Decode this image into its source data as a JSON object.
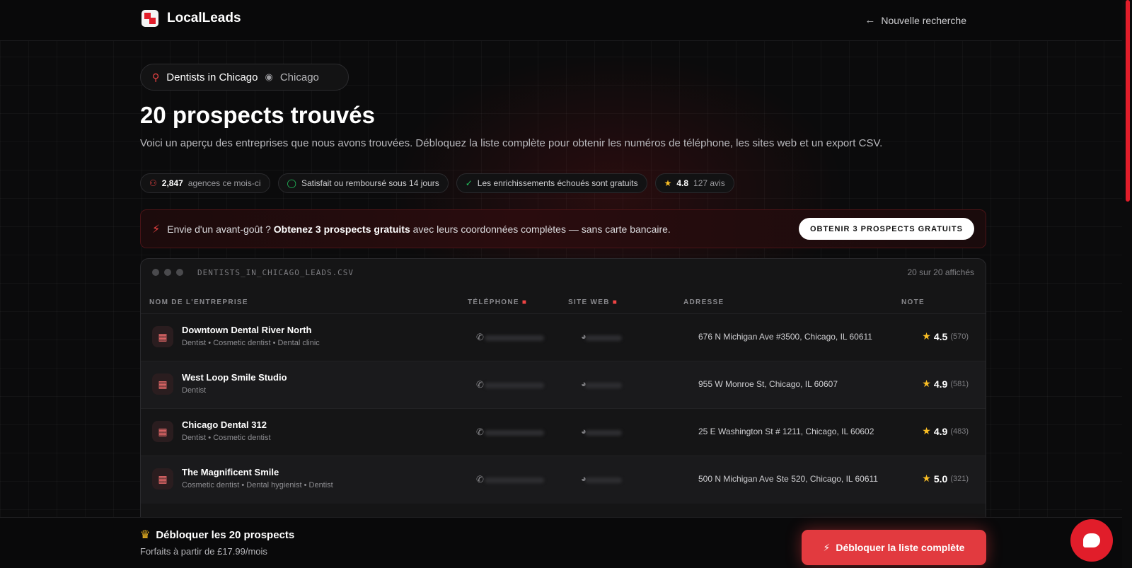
{
  "header": {
    "brand": "LocalLeads",
    "new_search": "Nouvelle recherche"
  },
  "search": {
    "query": "Dentists in Chicago",
    "location": "Chicago"
  },
  "main": {
    "title": "20 prospects trouvés",
    "intro": "Voici un aperçu des entreprises que nous avons trouvées. Débloquez la liste complète pour obtenir les numéros de téléphone, les sites web et un export CSV."
  },
  "badges": {
    "agencies_count": "2,847",
    "agencies_label": "agences ce mois-ci",
    "refund": "Satisfait ou remboursé sous 14 jours",
    "enrich": "Les enrichissements échoués sont gratuits",
    "rating": "4.8",
    "reviews": "127 avis"
  },
  "promo": {
    "lead": "Envie d'un avant-goût ?",
    "bold": "Obtenez 3 prospects gratuits",
    "rest": "avec leurs coordonnées complètes — sans carte bancaire.",
    "button": "OBTENIR 3 PROSPECTS GRATUITS"
  },
  "table": {
    "filename": "DENTISTS_IN_CHICAGO_LEADS.CSV",
    "shown": "20 sur 20 affichés",
    "headers": {
      "name": "NOM DE L'ENTREPRISE",
      "phone": "TÉLÉPHONE",
      "website": "SITE WEB",
      "address": "ADRESSE",
      "rating": "NOTE"
    },
    "rows": [
      {
        "name": "Downtown Dental River North",
        "categories": "Dentist • Cosmetic dentist • Dental clinic",
        "address": "676 N Michigan Ave #3500, Chicago, IL 60611",
        "rating": "4.5",
        "reviews": "(570)"
      },
      {
        "name": "West Loop Smile Studio",
        "categories": "Dentist",
        "address": "955 W Monroe St, Chicago, IL 60607",
        "rating": "4.9",
        "reviews": "(581)"
      },
      {
        "name": "Chicago Dental 312",
        "categories": "Dentist • Cosmetic dentist",
        "address": "25 E Washington St # 1211, Chicago, IL 60602",
        "rating": "4.9",
        "reviews": "(483)"
      },
      {
        "name": "The Magnificent Smile",
        "categories": "Cosmetic dentist • Dental hygienist • Dentist",
        "address": "500 N Michigan Ave Ste 520, Chicago, IL 60611",
        "rating": "5.0",
        "reviews": "(321)"
      }
    ]
  },
  "footer": {
    "title": "Débloquer les 20 prospects",
    "subtitle": "Forfaits à partir de £17.99/mois",
    "button": "Débloquer la liste complète"
  },
  "colors": {
    "accent": "#e11d2a",
    "star": "#fbbf24",
    "background": "#0b0b0c"
  },
  "icons": [
    "search-icon",
    "map-pin-icon",
    "arrow-left-icon",
    "users-icon",
    "shield-icon",
    "check-icon",
    "star-icon",
    "bolt-icon",
    "lock-icon",
    "building-icon",
    "phone-icon",
    "globe-icon",
    "crown-icon",
    "chat-icon"
  ]
}
